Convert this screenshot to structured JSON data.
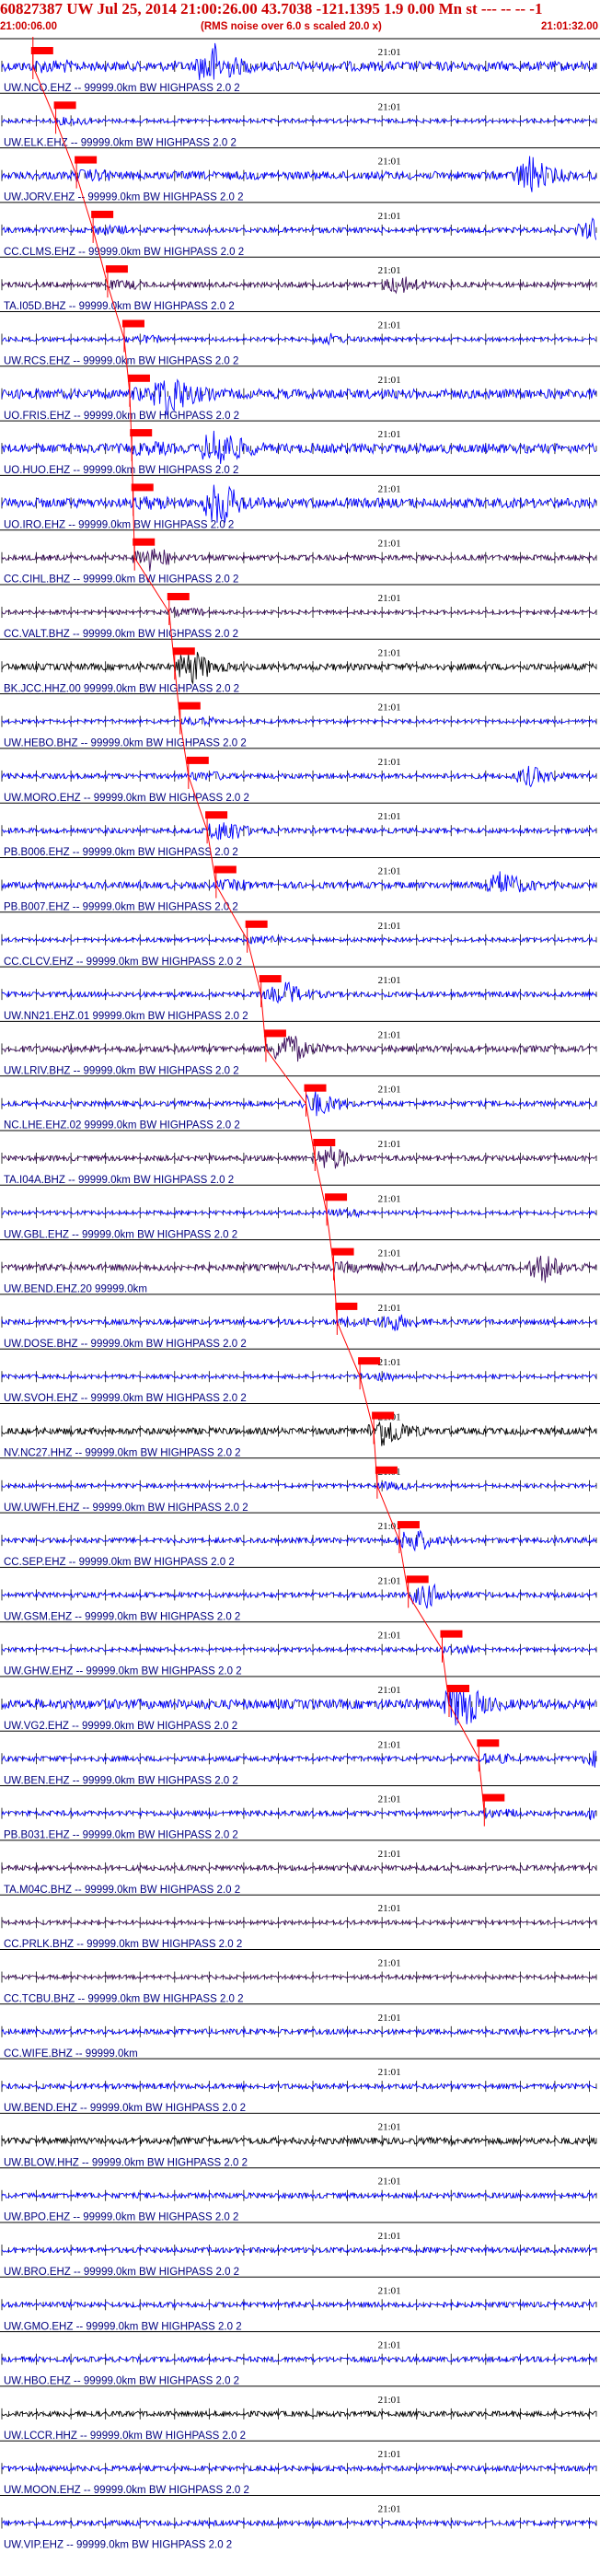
{
  "header": {
    "event_line": "60827387 UW Jul 25, 2014 21:00:26.00   43.7038 -121.1395  1.9 0.00 Mn st --- -- -- -1",
    "start_time": "21:00:06.00",
    "note": "(RMS noise over 6.0 s scaled 20.0 x)",
    "end_time": "21:01:32.00"
  },
  "colors": {
    "trace_blue": "#0000ff",
    "trace_purple": "#3c0d5c",
    "trace_black": "#000000",
    "pick_red": "#ff0000",
    "label_navy": "#000080"
  },
  "chart_data": {
    "type": "line",
    "title": "60827387 UW Jul 25, 2014 21:00:26.00   43.7038 -121.1395  1.9 0.00 Mn st --- -- -- -1",
    "x_range": [
      "21:00:06.00",
      "21:01:32.00"
    ],
    "x_tick_label": "21:01",
    "origin_time": "21:00:26.00",
    "series": [
      {
        "name": "UW.NCO.EHZ -- 99999.0km BW  HIGHPASS  2.0  2",
        "color": "#0000ff",
        "p_pick_time_s": 4.5,
        "amplitude": 5,
        "burst_time_s": 29
      },
      {
        "name": "UW.ELK.EHZ -- 99999.0km BW  HIGHPASS  2.0  2",
        "color": "#0000ff",
        "p_pick_time_s": 7.8,
        "amplitude": 1,
        "burst_time_s": 0
      },
      {
        "name": "UW.JORV.EHZ -- 99999.0km BW  HIGHPASS  2.0  2",
        "color": "#0000ff",
        "p_pick_time_s": 10.8,
        "amplitude": 4,
        "burst_time_s": 75
      },
      {
        "name": "CC.CLMS.EHZ -- 99999.0km BW  HIGHPASS  2.0  2",
        "color": "#0000ff",
        "p_pick_time_s": 13.2,
        "amplitude": 2,
        "burst_time_s": 84
      },
      {
        "name": "TA.I05D.BHZ -- 99999.0km BW  HIGHPASS  2.0  2",
        "color": "#3c0d5c",
        "p_pick_time_s": 15.3,
        "amplitude": 2,
        "burst_time_s": 56
      },
      {
        "name": "UW.RCS.EHZ -- 99999.0km BW  HIGHPASS  2.0  2",
        "color": "#0000ff",
        "p_pick_time_s": 17.7,
        "amplitude": 1,
        "burst_time_s": 46
      },
      {
        "name": "UO.FRIS.EHZ -- 99999.0km BW  HIGHPASS  2.0  2",
        "color": "#0000ff",
        "p_pick_time_s": 18.5,
        "amplitude": 5,
        "burst_time_s": 23
      },
      {
        "name": "UO.HUO.EHZ -- 99999.0km BW  HIGHPASS  2.0  2",
        "color": "#0000ff",
        "p_pick_time_s": 18.8,
        "amplitude": 5,
        "burst_time_s": 30
      },
      {
        "name": "UO.IRO.EHZ -- 99999.0km BW  HIGHPASS  2.0  2",
        "color": "#0000ff",
        "p_pick_time_s": 19.0,
        "amplitude": 5,
        "burst_time_s": 30
      },
      {
        "name": "CC.CIHL.BHZ -- 99999.0km BW  HIGHPASS  2.0  2",
        "color": "#3c0d5c",
        "p_pick_time_s": 19.2,
        "amplitude": 2,
        "burst_time_s": 20
      },
      {
        "name": "CC.VALT.BHZ -- 99999.0km BW  HIGHPASS  2.0  2",
        "color": "#3c0d5c",
        "p_pick_time_s": 24.2,
        "amplitude": 1,
        "burst_time_s": 0
      },
      {
        "name": "BK.JCC.HHZ.00 99999.0km BW  HIGHPASS  2.0  2",
        "color": "#000000",
        "p_pick_time_s": 25.0,
        "amplitude": 3,
        "burst_time_s": 26
      },
      {
        "name": "UW.HEBO.BHZ -- 99999.0km BW  HIGHPASS  2.0  2",
        "color": "#0000ff",
        "p_pick_time_s": 25.8,
        "amplitude": 1,
        "burst_time_s": 0
      },
      {
        "name": "UW.MORO.EHZ -- 99999.0km BW  HIGHPASS  2.0  2",
        "color": "#0000ff",
        "p_pick_time_s": 27.0,
        "amplitude": 2,
        "burst_time_s": 75
      },
      {
        "name": "PB.B006.EHZ -- 99999.0km BW  HIGHPASS  2.0  2",
        "color": "#0000ff",
        "p_pick_time_s": 29.7,
        "amplitude": 2,
        "burst_time_s": 31
      },
      {
        "name": "PB.B007.EHZ -- 99999.0km BW  HIGHPASS  2.0  2",
        "color": "#0000ff",
        "p_pick_time_s": 31.0,
        "amplitude": 3,
        "burst_time_s": 71
      },
      {
        "name": "CC.CLCV.EHZ -- 99999.0km BW  HIGHPASS  2.0  2",
        "color": "#0000ff",
        "p_pick_time_s": 35.5,
        "amplitude": 1,
        "burst_time_s": 0
      },
      {
        "name": "UW.NN21.EHZ.01 99999.0km BW  HIGHPASS  2.0  2",
        "color": "#0000ff",
        "p_pick_time_s": 37.5,
        "amplitude": 2,
        "burst_time_s": 40
      },
      {
        "name": "UW.LRIV.BHZ -- 99999.0km BW  HIGHPASS  2.0  2",
        "color": "#3c0d5c",
        "p_pick_time_s": 38.2,
        "amplitude": 3,
        "burst_time_s": 40
      },
      {
        "name": "NC.LHE.EHZ.02 99999.0km BW  HIGHPASS  2.0  2",
        "color": "#0000ff",
        "p_pick_time_s": 44.0,
        "amplitude": 2,
        "burst_time_s": 44
      },
      {
        "name": "TA.I04A.BHZ -- 99999.0km BW  HIGHPASS  2.0  2",
        "color": "#3c0d5c",
        "p_pick_time_s": 45.3,
        "amplitude": 2,
        "burst_time_s": 46
      },
      {
        "name": "UW.GBL.EHZ -- 99999.0km BW  HIGHPASS  2.0  2",
        "color": "#0000ff",
        "p_pick_time_s": 47.0,
        "amplitude": 1,
        "burst_time_s": 0
      },
      {
        "name": "UW.BEND.EHZ.20 99999.0km",
        "color": "#3c0d5c",
        "p_pick_time_s": 48.0,
        "amplitude": 3,
        "burst_time_s": 77
      },
      {
        "name": "UW.DOSE.BHZ -- 99999.0km BW  HIGHPASS  2.0  2",
        "color": "#0000ff",
        "p_pick_time_s": 48.5,
        "amplitude": 2,
        "burst_time_s": 55
      },
      {
        "name": "UW.SVOH.EHZ -- 99999.0km BW  HIGHPASS  2.0  2",
        "color": "#0000ff",
        "p_pick_time_s": 51.8,
        "amplitude": 1,
        "burst_time_s": 0
      },
      {
        "name": "NV.NC27.HHZ -- 99999.0km BW  HIGHPASS  2.0  2",
        "color": "#000000",
        "p_pick_time_s": 53.8,
        "amplitude": 3,
        "burst_time_s": 54
      },
      {
        "name": "UW.UWFH.EHZ -- 99999.0km BW  HIGHPASS  2.0  2",
        "color": "#0000ff",
        "p_pick_time_s": 54.3,
        "amplitude": 1,
        "burst_time_s": 0
      },
      {
        "name": "CC.SEP.EHZ -- 99999.0km BW  HIGHPASS  2.0  2",
        "color": "#0000ff",
        "p_pick_time_s": 57.5,
        "amplitude": 2,
        "burst_time_s": 58
      },
      {
        "name": "UW.GSM.EHZ -- 99999.0km BW  HIGHPASS  2.0  2",
        "color": "#0000ff",
        "p_pick_time_s": 58.8,
        "amplitude": 2,
        "burst_time_s": 60
      },
      {
        "name": "UW.GHW.EHZ -- 99999.0km BW  HIGHPASS  2.0  2",
        "color": "#0000ff",
        "p_pick_time_s": 63.7,
        "amplitude": 1,
        "burst_time_s": 0
      },
      {
        "name": "UW.VG2.EHZ -- 99999.0km BW  HIGHPASS  2.0  2",
        "color": "#0000ff",
        "p_pick_time_s": 64.7,
        "amplitude": 5,
        "burst_time_s": 65
      },
      {
        "name": "UW.BEN.EHZ -- 99999.0km BW  HIGHPASS  2.0  2",
        "color": "#0000ff",
        "p_pick_time_s": 69.0,
        "amplitude": 2,
        "burst_time_s": 85
      },
      {
        "name": "PB.B031.EHZ -- 99999.0km BW  HIGHPASS  2.0  2",
        "color": "#0000ff",
        "p_pick_time_s": 69.8,
        "amplitude": 2,
        "burst_time_s": 85
      },
      {
        "name": "TA.M04C.BHZ -- 99999.0km BW  HIGHPASS  2.0  2",
        "color": "#3c0d5c",
        "p_pick_time_s": null,
        "amplitude": 2,
        "burst_time_s": 0
      },
      {
        "name": "CC.PRLK.BHZ -- 99999.0km BW  HIGHPASS  2.0  2",
        "color": "#3c0d5c",
        "p_pick_time_s": null,
        "amplitude": 1,
        "burst_time_s": 0
      },
      {
        "name": "CC.TCBU.BHZ -- 99999.0km BW  HIGHPASS  2.0  2",
        "color": "#3c0d5c",
        "p_pick_time_s": null,
        "amplitude": 1,
        "burst_time_s": 0
      },
      {
        "name": "CC.WIFE.BHZ -- 99999.0km",
        "color": "#0000ff",
        "p_pick_time_s": null,
        "amplitude": 2,
        "burst_time_s": 0
      },
      {
        "name": "UW.BEND.EHZ -- 99999.0km BW  HIGHPASS  2.0  2",
        "color": "#0000ff",
        "p_pick_time_s": null,
        "amplitude": 2,
        "burst_time_s": 0
      },
      {
        "name": "UW.BLOW.HHZ -- 99999.0km BW  HIGHPASS  2.0  2",
        "color": "#000000",
        "p_pick_time_s": null,
        "amplitude": 3,
        "burst_time_s": 0
      },
      {
        "name": "UW.BPO.EHZ -- 99999.0km BW  HIGHPASS  2.0  2",
        "color": "#0000ff",
        "p_pick_time_s": null,
        "amplitude": 2,
        "burst_time_s": 0
      },
      {
        "name": "UW.BRO.EHZ -- 99999.0km BW  HIGHPASS  2.0  2",
        "color": "#0000ff",
        "p_pick_time_s": null,
        "amplitude": 2,
        "burst_time_s": 0
      },
      {
        "name": "UW.GMO.EHZ -- 99999.0km BW  HIGHPASS  2.0  2",
        "color": "#0000ff",
        "p_pick_time_s": null,
        "amplitude": 2,
        "burst_time_s": 0
      },
      {
        "name": "UW.HBO.EHZ -- 99999.0km BW  HIGHPASS  2.0  2",
        "color": "#0000ff",
        "p_pick_time_s": null,
        "amplitude": 2,
        "burst_time_s": 0
      },
      {
        "name": "UW.LCCR.HHZ -- 99999.0km BW  HIGHPASS  2.0  2",
        "color": "#000000",
        "p_pick_time_s": null,
        "amplitude": 2,
        "burst_time_s": 0
      },
      {
        "name": "UW.MOON.EHZ -- 99999.0km BW  HIGHPASS  2.0  2",
        "color": "#0000ff",
        "p_pick_time_s": null,
        "amplitude": 2,
        "burst_time_s": 0
      },
      {
        "name": "UW.VIP.EHZ -- 99999.0km BW  HIGHPASS  2.0  2",
        "color": "#0000ff",
        "p_pick_time_s": null,
        "amplitude": 2,
        "burst_time_s": 0
      }
    ]
  }
}
